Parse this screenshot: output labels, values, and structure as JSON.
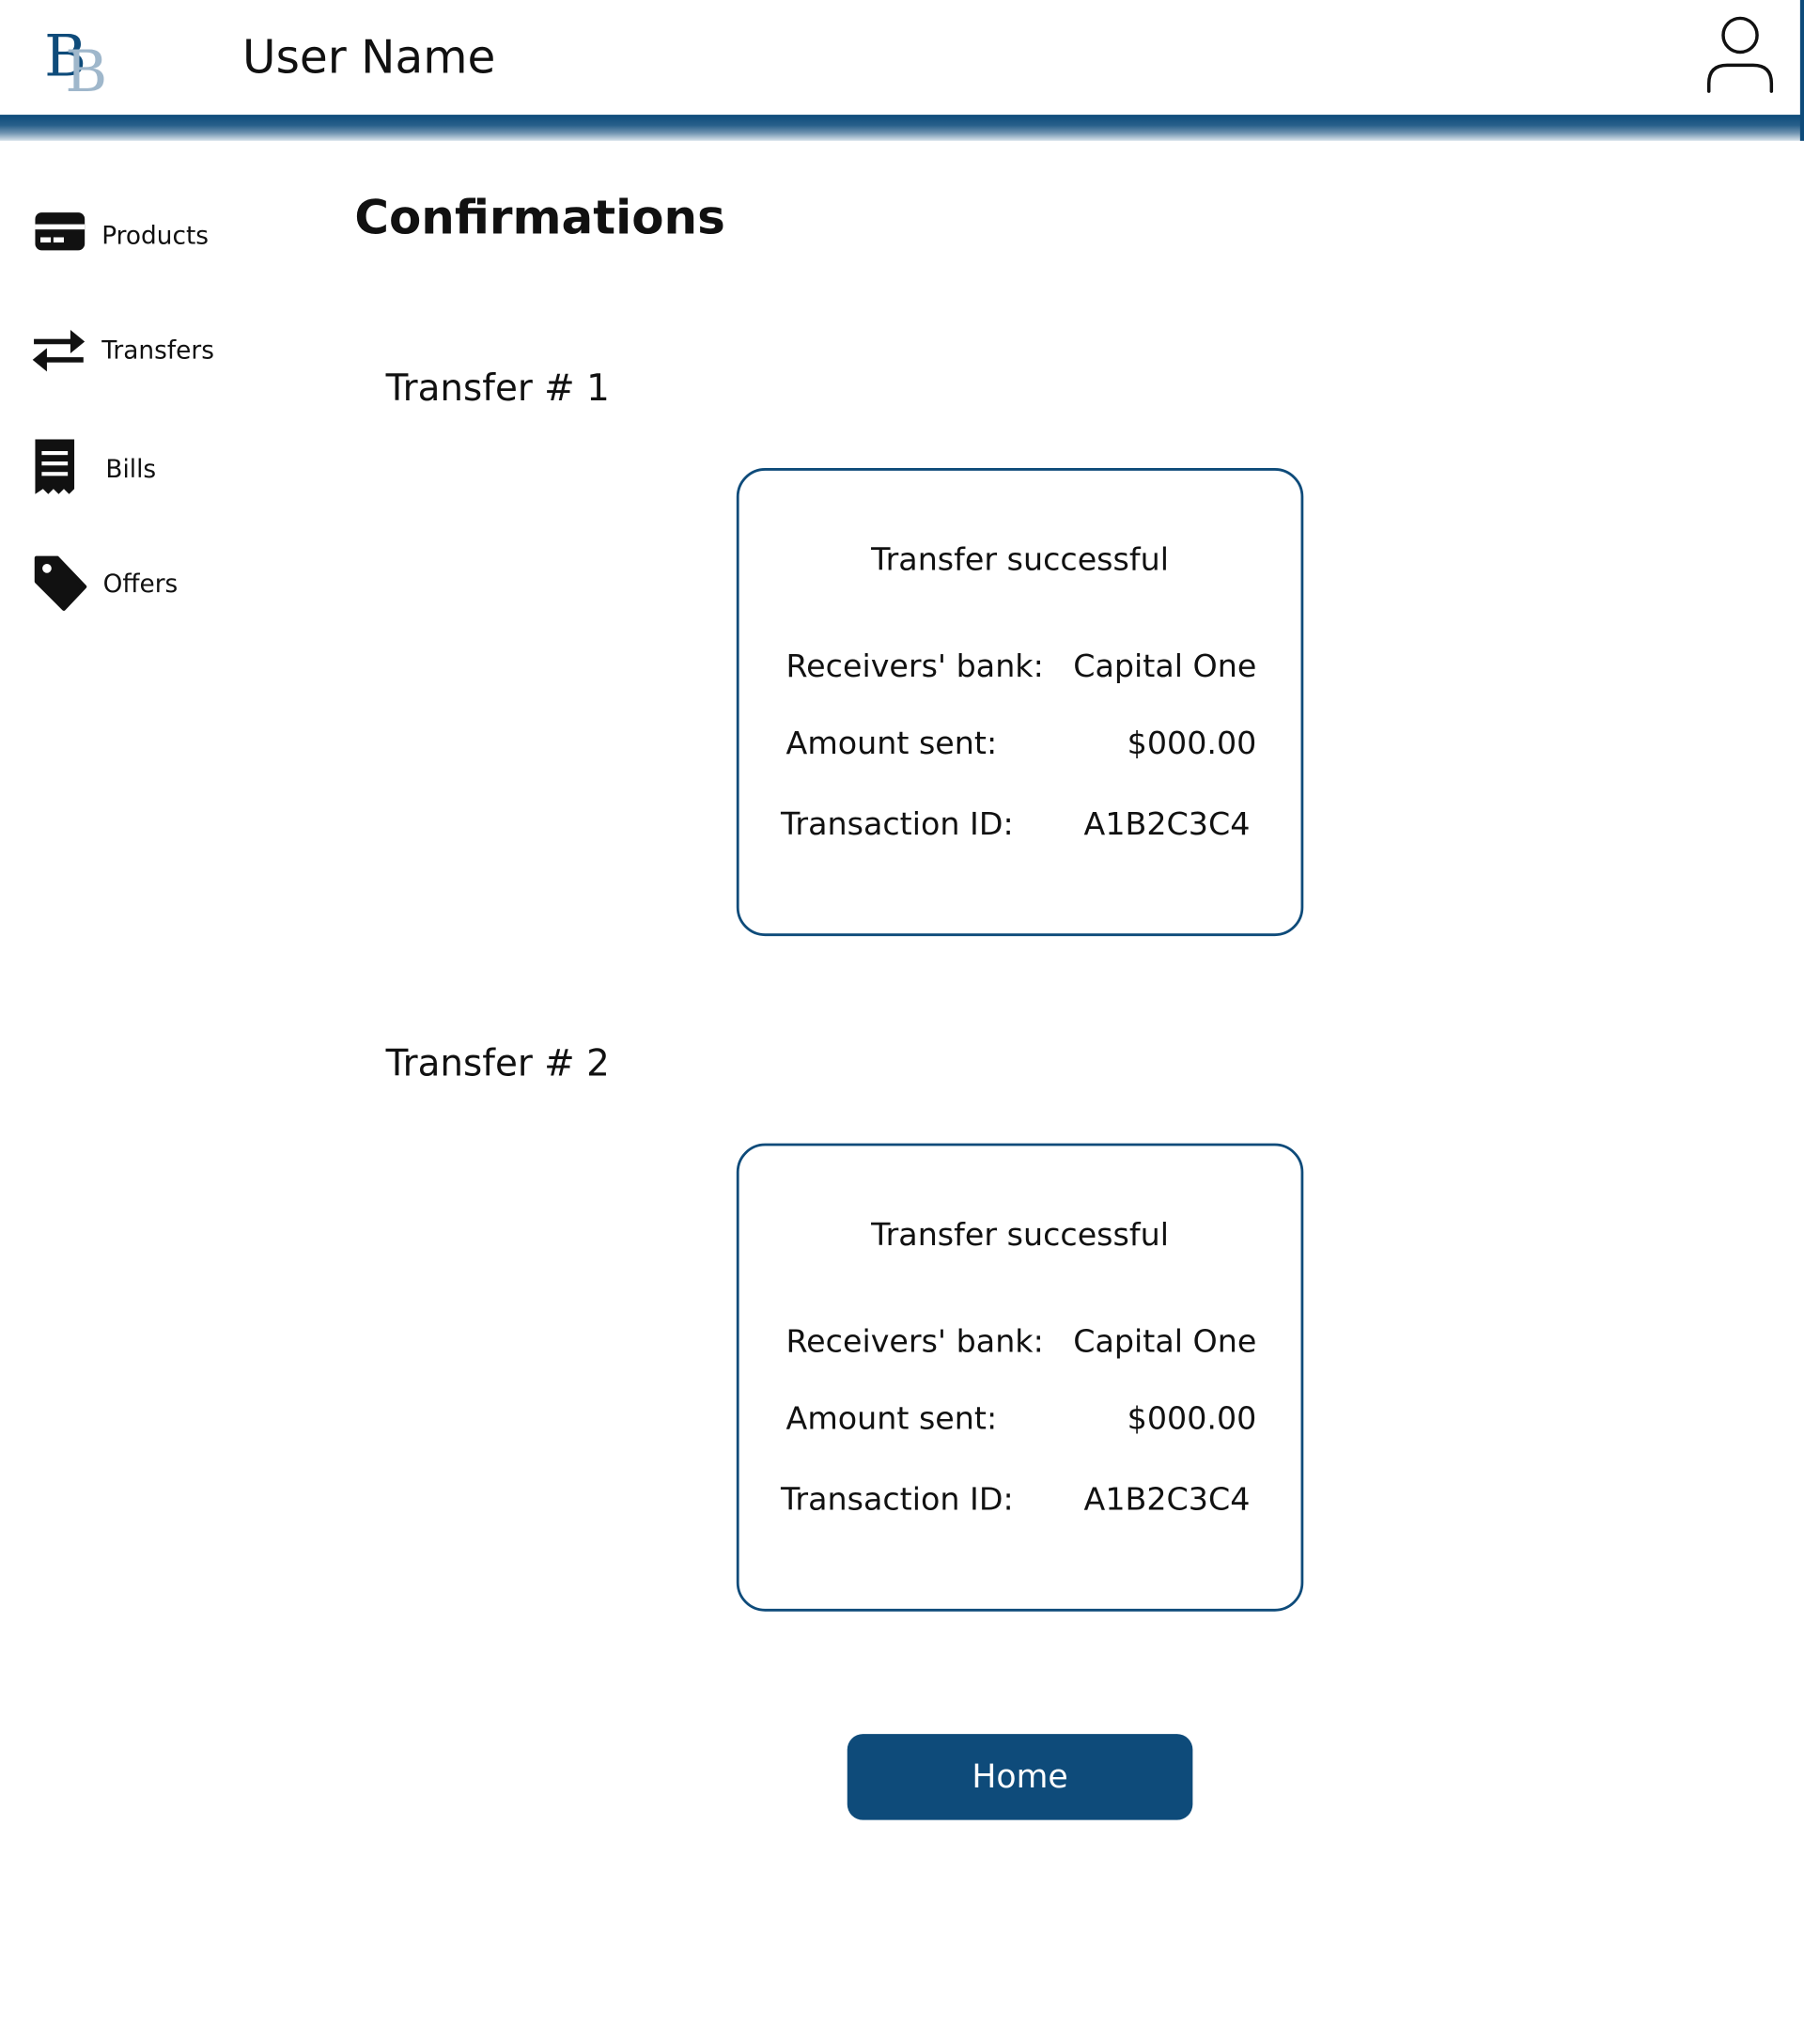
{
  "header": {
    "logo_text": "BB",
    "user_name": "User Name",
    "avatar_icon": "user-icon"
  },
  "sidebar": {
    "items": [
      {
        "label": "Products",
        "icon": "credit-card-icon"
      },
      {
        "label": "Transfers",
        "icon": "transfer-arrows-icon"
      },
      {
        "label": "Bills",
        "icon": "receipt-icon"
      },
      {
        "label": "Offers",
        "icon": "tag-icon"
      }
    ]
  },
  "main": {
    "title": "Confirmations",
    "transfers": [
      {
        "heading": "Transfer # 1",
        "status": "Transfer successful",
        "bank_label": "Receivers' bank:",
        "bank_value": "Capital One",
        "amount_label": "Amount sent:",
        "amount_value": "$000.00",
        "id_label": "Transaction ID:",
        "id_value": "A1B2C3C4"
      },
      {
        "heading": "Transfer # 2",
        "status": "Transfer successful",
        "bank_label": "Receivers' bank:",
        "bank_value": "Capital One",
        "amount_label": "Amount sent:",
        "amount_value": "$000.00",
        "id_label": "Transaction ID:",
        "id_value": "A1B2C3C4"
      }
    ],
    "home_label": "Home"
  },
  "colors": {
    "brand": "#0e4b7a",
    "brand_light": "#9fb7cb",
    "text": "#111111",
    "background": "#ffffff"
  }
}
